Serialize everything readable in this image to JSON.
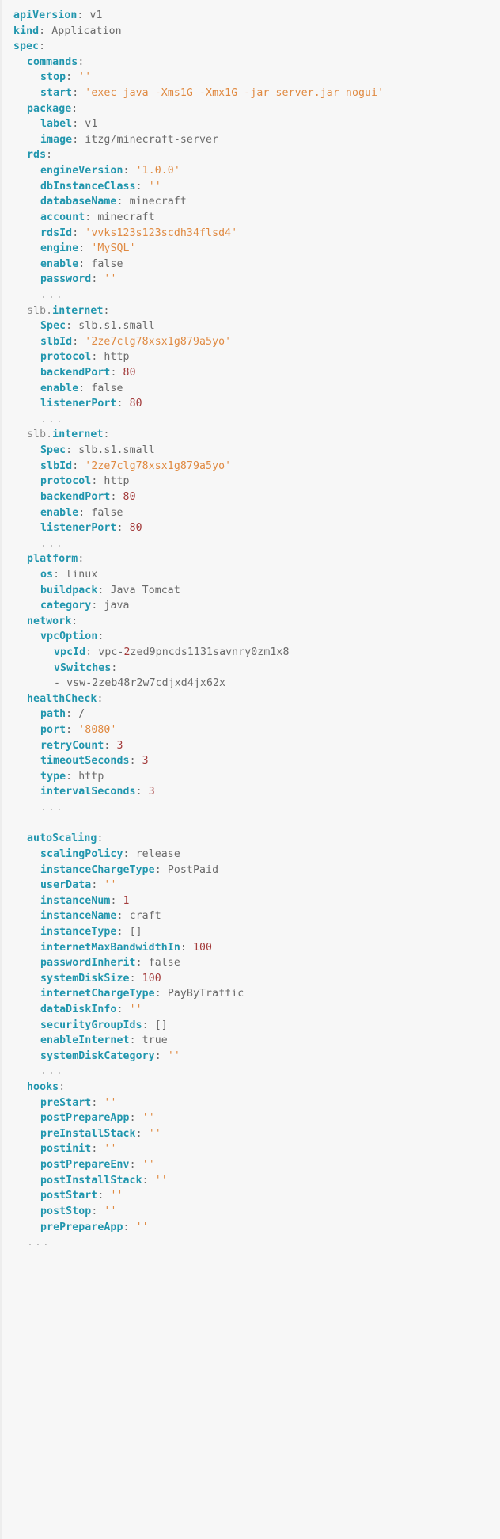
{
  "document": {
    "type": "yaml-code-block",
    "language": "yaml",
    "colors": {
      "background": "#f7f7f7",
      "key": "#2196ae",
      "plain_value": "#6a6a6a",
      "string_value": "#e08a42",
      "number_value": "#a33b3b",
      "ellipsis": "#b0b0b0",
      "left_rule": "#ededed"
    },
    "lines": [
      {
        "indent": 0,
        "key": "apiVersion",
        "value": "v1",
        "kind": "plain"
      },
      {
        "indent": 0,
        "key": "kind",
        "value": "Application",
        "kind": "plain"
      },
      {
        "indent": 0,
        "key": "spec",
        "value": "",
        "kind": "mapping"
      },
      {
        "indent": 1,
        "key": "commands",
        "value": "",
        "kind": "mapping"
      },
      {
        "indent": 2,
        "key": "stop",
        "value": "''",
        "kind": "string"
      },
      {
        "indent": 2,
        "key": "start",
        "value": "'exec java -Xms1G -Xmx1G -jar server.jar nogui'",
        "kind": "string"
      },
      {
        "indent": 1,
        "key": "package",
        "value": "",
        "kind": "mapping"
      },
      {
        "indent": 2,
        "key": "label",
        "value": "v1",
        "kind": "plain"
      },
      {
        "indent": 2,
        "key": "image",
        "value": "itzg/minecraft-server",
        "kind": "plain"
      },
      {
        "indent": 1,
        "key": "rds",
        "value": "",
        "kind": "mapping"
      },
      {
        "indent": 2,
        "key": "engineVersion",
        "value": "'1.0.0'",
        "kind": "string"
      },
      {
        "indent": 2,
        "key": "dbInstanceClass",
        "value": "''",
        "kind": "string"
      },
      {
        "indent": 2,
        "key": "databaseName",
        "value": "minecraft",
        "kind": "plain"
      },
      {
        "indent": 2,
        "key": "account",
        "value": "minecraft",
        "kind": "plain"
      },
      {
        "indent": 2,
        "key": "rdsId",
        "value": "'vvks123s123scdh34flsd4'",
        "kind": "string"
      },
      {
        "indent": 2,
        "key": "engine",
        "value": "'MySQL'",
        "kind": "string"
      },
      {
        "indent": 2,
        "key": "enable",
        "value": "false",
        "kind": "plain"
      },
      {
        "indent": 2,
        "key": "password",
        "value": "''",
        "kind": "string"
      },
      {
        "indent": 2,
        "key": "",
        "value": "...",
        "kind": "ellipsis"
      },
      {
        "indent": 1,
        "prefix": "slb.",
        "key": "internet",
        "value": "",
        "kind": "mapping"
      },
      {
        "indent": 2,
        "key": "Spec",
        "value": "slb.s1.small",
        "kind": "plain"
      },
      {
        "indent": 2,
        "key": "slbId",
        "value": "'2ze7clg78xsx1g879a5yo'",
        "kind": "string"
      },
      {
        "indent": 2,
        "key": "protocol",
        "value": "http",
        "kind": "plain"
      },
      {
        "indent": 2,
        "key": "backendPort",
        "value": "80",
        "kind": "number"
      },
      {
        "indent": 2,
        "key": "enable",
        "value": "false",
        "kind": "plain"
      },
      {
        "indent": 2,
        "key": "listenerPort",
        "value": "80",
        "kind": "number"
      },
      {
        "indent": 2,
        "key": "",
        "value": "...",
        "kind": "ellipsis"
      },
      {
        "indent": 1,
        "prefix": "slb.",
        "key": "internet",
        "value": "",
        "kind": "mapping"
      },
      {
        "indent": 2,
        "key": "Spec",
        "value": "slb.s1.small",
        "kind": "plain"
      },
      {
        "indent": 2,
        "key": "slbId",
        "value": "'2ze7clg78xsx1g879a5yo'",
        "kind": "string"
      },
      {
        "indent": 2,
        "key": "protocol",
        "value": "http",
        "kind": "plain"
      },
      {
        "indent": 2,
        "key": "backendPort",
        "value": "80",
        "kind": "number"
      },
      {
        "indent": 2,
        "key": "enable",
        "value": "false",
        "kind": "plain"
      },
      {
        "indent": 2,
        "key": "listenerPort",
        "value": "80",
        "kind": "number"
      },
      {
        "indent": 2,
        "key": "",
        "value": "...",
        "kind": "ellipsis"
      },
      {
        "indent": 1,
        "key": "platform",
        "value": "",
        "kind": "mapping"
      },
      {
        "indent": 2,
        "key": "os",
        "value": "linux",
        "kind": "plain"
      },
      {
        "indent": 2,
        "key": "buildpack",
        "value": "Java Tomcat",
        "kind": "plain"
      },
      {
        "indent": 2,
        "key": "category",
        "value": "java",
        "kind": "plain"
      },
      {
        "indent": 1,
        "key": "network",
        "value": "",
        "kind": "mapping"
      },
      {
        "indent": 2,
        "key": "vpcOption",
        "value": "",
        "kind": "mapping"
      },
      {
        "indent": 3,
        "key": "vpcId",
        "value": "vpc-2zed9pncds1131savnry0zm1x8",
        "kind": "plain"
      },
      {
        "indent": 3,
        "key": "vSwitches",
        "value": "",
        "kind": "mapping"
      },
      {
        "indent": 3,
        "key": "",
        "value": "- vsw-2zeb48r2w7cdjxd4jx62x",
        "kind": "seq"
      },
      {
        "indent": 1,
        "key": "healthCheck",
        "value": "",
        "kind": "mapping"
      },
      {
        "indent": 2,
        "key": "path",
        "value": "/",
        "kind": "plain"
      },
      {
        "indent": 2,
        "key": "port",
        "value": "'8080'",
        "kind": "string"
      },
      {
        "indent": 2,
        "key": "retryCount",
        "value": "3",
        "kind": "number"
      },
      {
        "indent": 2,
        "key": "timeoutSeconds",
        "value": "3",
        "kind": "number"
      },
      {
        "indent": 2,
        "key": "type",
        "value": "http",
        "kind": "plain"
      },
      {
        "indent": 2,
        "key": "intervalSeconds",
        "value": "3",
        "kind": "number"
      },
      {
        "indent": 2,
        "key": "",
        "value": "...",
        "kind": "ellipsis"
      },
      {
        "indent": 0,
        "key": "",
        "value": "",
        "kind": "blank"
      },
      {
        "indent": 1,
        "key": "autoScaling",
        "value": "",
        "kind": "mapping"
      },
      {
        "indent": 2,
        "key": "scalingPolicy",
        "value": "release",
        "kind": "plain"
      },
      {
        "indent": 2,
        "key": "instanceChargeType",
        "value": "PostPaid",
        "kind": "plain"
      },
      {
        "indent": 2,
        "key": "userData",
        "value": "''",
        "kind": "string"
      },
      {
        "indent": 2,
        "key": "instanceNum",
        "value": "1",
        "kind": "number"
      },
      {
        "indent": 2,
        "key": "instanceName",
        "value": "craft",
        "kind": "plain"
      },
      {
        "indent": 2,
        "key": "instanceType",
        "value": "[]",
        "kind": "plain"
      },
      {
        "indent": 2,
        "key": "internetMaxBandwidthIn",
        "value": "100",
        "kind": "number"
      },
      {
        "indent": 2,
        "key": "passwordInherit",
        "value": "false",
        "kind": "plain"
      },
      {
        "indent": 2,
        "key": "systemDiskSize",
        "value": "100",
        "kind": "number"
      },
      {
        "indent": 2,
        "key": "internetChargeType",
        "value": "PayByTraffic",
        "kind": "plain"
      },
      {
        "indent": 2,
        "key": "dataDiskInfo",
        "value": "''",
        "kind": "string"
      },
      {
        "indent": 2,
        "key": "securityGroupIds",
        "value": "[]",
        "kind": "plain"
      },
      {
        "indent": 2,
        "key": "enableInternet",
        "value": "true",
        "kind": "plain"
      },
      {
        "indent": 2,
        "key": "systemDiskCategory",
        "value": "''",
        "kind": "string"
      },
      {
        "indent": 2,
        "key": "",
        "value": "...",
        "kind": "ellipsis"
      },
      {
        "indent": 1,
        "key": "hooks",
        "value": "",
        "kind": "mapping"
      },
      {
        "indent": 2,
        "key": "preStart",
        "value": "''",
        "kind": "string"
      },
      {
        "indent": 2,
        "key": "postPrepareApp",
        "value": "''",
        "kind": "string"
      },
      {
        "indent": 2,
        "key": "preInstallStack",
        "value": "''",
        "kind": "string"
      },
      {
        "indent": 2,
        "key": "postinit",
        "value": "''",
        "kind": "string"
      },
      {
        "indent": 2,
        "key": "postPrepareEnv",
        "value": "''",
        "kind": "string"
      },
      {
        "indent": 2,
        "key": "postInstallStack",
        "value": "''",
        "kind": "string"
      },
      {
        "indent": 2,
        "key": "postStart",
        "value": "''",
        "kind": "string"
      },
      {
        "indent": 2,
        "key": "postStop",
        "value": "''",
        "kind": "string"
      },
      {
        "indent": 2,
        "key": "prePrepareApp",
        "value": "''",
        "kind": "string"
      },
      {
        "indent": 1,
        "key": "",
        "value": "...",
        "kind": "ellipsis"
      }
    ]
  }
}
